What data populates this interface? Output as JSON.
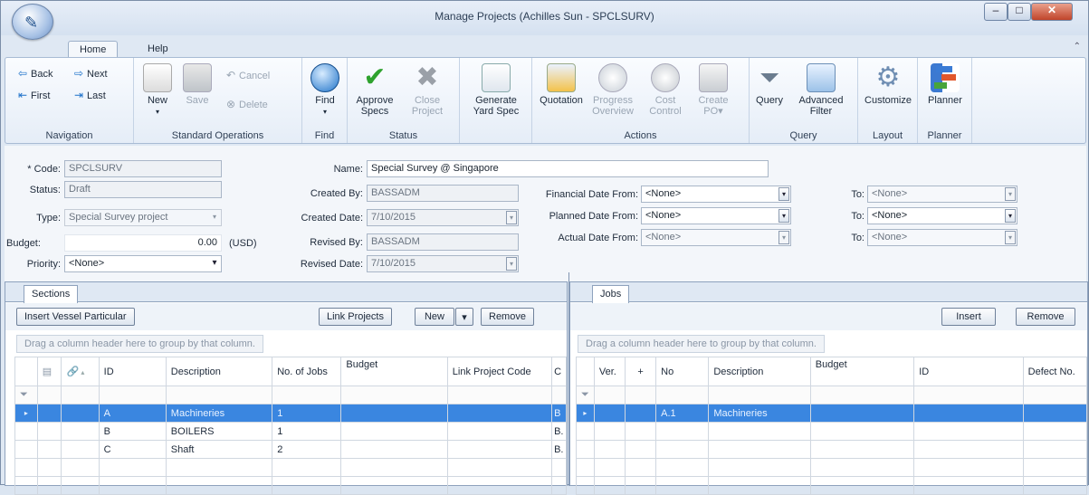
{
  "window": {
    "title": "Manage Projects (Achilles Sun - SPCLSURV)",
    "min": "–",
    "max": "□",
    "close": "✕"
  },
  "ribbon_tabs": [
    "Home",
    "Help"
  ],
  "ribbon": {
    "navigation": {
      "label": "Navigation",
      "back": "Back",
      "next": "Next",
      "first": "First",
      "last": "Last"
    },
    "standard": {
      "label": "Standard Operations",
      "new": "New",
      "save": "Save",
      "cancel": "Cancel",
      "delete": "Delete"
    },
    "find": {
      "label": "Find",
      "find": "Find"
    },
    "status": {
      "label": "Status",
      "approve1": "Approve",
      "approve2": "Specs",
      "close1": "Close",
      "close2": "Project"
    },
    "gen": {
      "gen1": "Generate",
      "gen2": "Yard Spec"
    },
    "actions": {
      "label": "Actions",
      "quotation": "Quotation",
      "progress1": "Progress",
      "progress2": "Overview",
      "cost1": "Cost",
      "cost2": "Control",
      "create1": "Create",
      "create2": "PO▾"
    },
    "query": {
      "label": "Query",
      "query": "Query",
      "adv1": "Advanced",
      "adv2": "Filter"
    },
    "layout": {
      "label": "Layout",
      "customize": "Customize"
    },
    "planner": {
      "label": "Planner",
      "planner": "Planner"
    }
  },
  "form": {
    "code_label": "* Code:",
    "code": "SPCLSURV",
    "status_label": "Status:",
    "status": "Draft",
    "type_label": "Type:",
    "type": "Special Survey project",
    "budget_label": "Budget:",
    "budget": "0.00",
    "currency": "(USD)",
    "priority_label": "Priority:",
    "priority": "<None>",
    "name_label": "Name:",
    "name": "Special Survey @ Singapore",
    "created_by_label": "Created By:",
    "created_by": "BASSADM",
    "created_date_label": "Created Date:",
    "created_date": "7/10/2015",
    "revised_by_label": "Revised By:",
    "revised_by": "BASSADM",
    "revised_date_label": "Revised Date:",
    "revised_date": "7/10/2015",
    "fin_from_label": "Financial Date From:",
    "fin_from": "<None>",
    "planned_from_label": "Planned Date From:",
    "planned_from": "<None>",
    "actual_from_label": "Actual Date From:",
    "actual_from": "<None>",
    "to_label": "To:",
    "fin_to": "<None>",
    "planned_to": "<None>",
    "actual_to": "<None>"
  },
  "sections": {
    "tab": "Sections",
    "insert_btn": "Insert Vessel Particular",
    "link_btn": "Link Projects",
    "new_btn": "New",
    "new_caret": "▾",
    "remove_btn": "Remove",
    "group_hint": "Drag a column header here to group by that column.",
    "columns": [
      "ID",
      "Description",
      "No. of Jobs",
      "Budget",
      "Link Project Code",
      "C"
    ],
    "rows": [
      [
        "A",
        "Machineries",
        "1",
        "",
        "",
        "B"
      ],
      [
        "B",
        "BOILERS",
        "1",
        "",
        "",
        "B."
      ],
      [
        "C",
        "Shaft",
        "2",
        "",
        "",
        "B."
      ]
    ]
  },
  "jobs": {
    "tab": "Jobs",
    "insert_btn": "Insert",
    "remove_btn": "Remove",
    "group_hint": "Drag a column header here to group by that column.",
    "columns": [
      "Ver.",
      "+",
      "No",
      "Description",
      "Budget",
      "ID",
      "Defect No."
    ],
    "rows": [
      [
        "",
        "",
        "A.1",
        "Machineries",
        "",
        "",
        ""
      ]
    ]
  }
}
